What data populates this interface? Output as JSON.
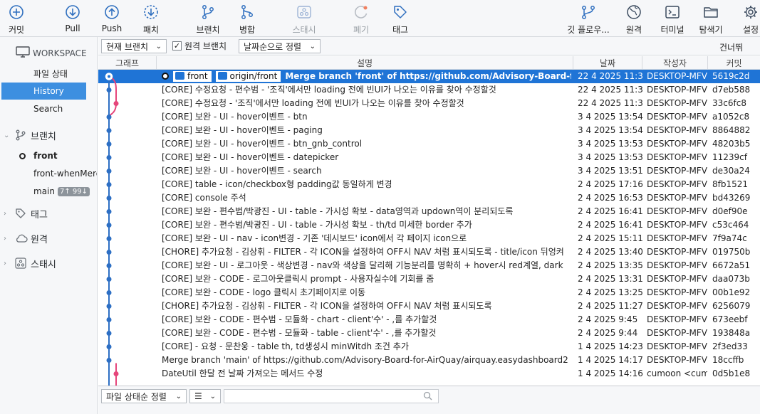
{
  "toolbar": {
    "left": [
      {
        "label": "커밋",
        "icon": "plus-circle-icon"
      },
      {
        "label": "Pull",
        "icon": "arrow-down-circle-icon"
      },
      {
        "label": "Push",
        "icon": "arrow-up-circle-icon"
      },
      {
        "label": "패치",
        "icon": "arrow-down-dashed-circle-icon"
      },
      {
        "label": "브랜치",
        "icon": "branch-icon"
      },
      {
        "label": "병합",
        "icon": "merge-icon"
      },
      {
        "label": "스태시",
        "icon": "stash-icon"
      },
      {
        "label": "폐기",
        "icon": "discard-icon"
      },
      {
        "label": "태그",
        "icon": "tag-icon"
      }
    ],
    "right": [
      {
        "label": "깃 플로우...",
        "icon": "git-flow-icon"
      },
      {
        "label": "원격",
        "icon": "globe-icon"
      },
      {
        "label": "터미널",
        "icon": "terminal-icon"
      },
      {
        "label": "탐색기",
        "icon": "folder-icon"
      },
      {
        "label": "설정",
        "icon": "gear-icon"
      }
    ]
  },
  "sidebar": {
    "workspace_label": "WORKSPACE",
    "workspace_items": [
      "파일 상태",
      "History",
      "Search"
    ],
    "selected_workspace_item": "History",
    "branches_label": "브랜치",
    "branches": [
      {
        "name": "front",
        "current": true
      },
      {
        "name": "front-whenMerge",
        "current": false
      },
      {
        "name": "main",
        "badge": "7↑ 99↓"
      }
    ],
    "tags_label": "태그",
    "remotes_label": "원격",
    "stash_label": "스태시"
  },
  "filter": {
    "branch_select": "현재 브랜치",
    "remote_branches_label": "원격 브랜치",
    "remote_branches_checked": true,
    "sort_select": "날짜순으로 정렬",
    "skip_label": "건너뛰"
  },
  "columns": {
    "graph": "그래프",
    "description": "설명",
    "date": "날짜",
    "author": "작성자",
    "commit": "커밋"
  },
  "commits": [
    {
      "tags": [
        "front",
        "origin/front"
      ],
      "desc": "Merge branch 'front' of https://github.com/Advisory-Board-for-AirQuay/airquay.easydashboard2 into front",
      "date": "22 4 2025 11:3",
      "author": "DESKTOP-MFV",
      "hash": "5619c2d",
      "selected": true
    },
    {
      "desc": "[CORE] 수정요청  - 편수범 - '조직'에서만 loading 전에 빈UI가 나오는 이유를 찾아 수정할것",
      "date": "22 4 2025 11:3",
      "author": "DESKTOP-MFV",
      "hash": "d7eb588"
    },
    {
      "desc": "[CORE] 수정요청 - '조직'에서만 loading 전에 빈UI가 나오는 이유를 찾아 수정할것",
      "date": "22 4 2025 11:3",
      "author": "DESKTOP-MFV",
      "hash": "33c6fc8"
    },
    {
      "desc": "[CORE] 보완 - UI - hover이벤트 - btn",
      "date": "3 4 2025 13:54",
      "author": "DESKTOP-MFV",
      "hash": "a1052c8"
    },
    {
      "desc": "[CORE] 보완 - UI - hover이벤트 - paging",
      "date": "3 4 2025 13:54",
      "author": "DESKTOP-MFV",
      "hash": "8864882"
    },
    {
      "desc": "[CORE] 보완 - UI - hover이벤트 - btn_gnb_control",
      "date": "3 4 2025 13:53",
      "author": "DESKTOP-MFV",
      "hash": "48203b5"
    },
    {
      "desc": "[CORE] 보완 - UI - hover이벤트 - datepicker",
      "date": "3 4 2025 13:53",
      "author": "DESKTOP-MFV",
      "hash": "11239cf"
    },
    {
      "desc": "[CORE] 보완 - UI - hover이벤트 - search",
      "date": "3 4 2025 13:51",
      "author": "DESKTOP-MFV",
      "hash": "de30a24"
    },
    {
      "desc": "[CORE] table - icon/checkbox형 padding값 동일하게 변경",
      "date": "2 4 2025 17:16",
      "author": "DESKTOP-MFV",
      "hash": "8fb1521"
    },
    {
      "desc": "[CORE] console 주석",
      "date": "2 4 2025 16:53",
      "author": "DESKTOP-MFV",
      "hash": "bd43269"
    },
    {
      "desc": "[CORE] 보완 - 편수범/박광진 - UI - table - 가시성 확보 - data영역과 updown역이 분리되도록",
      "date": "2 4 2025 16:41",
      "author": "DESKTOP-MFV",
      "hash": "d0ef90e"
    },
    {
      "desc": "[CORE] 보완 - 편수범/박광진 - UI - table - 가시성 확보 -  th/td 미세한 border 추가",
      "date": "2 4 2025 16:41",
      "author": "DESKTOP-MFV",
      "hash": "c53c464"
    },
    {
      "desc": "[CORE] 보완 - UI - nav - icon변경 - 기존 '데시보드' icon에서 각 페이지 icon으로",
      "date": "2 4 2025 15:11",
      "author": "DESKTOP-MFV",
      "hash": "7f9a74c"
    },
    {
      "desc": "[CHORE]  추가요청 - 김상휘 - FILTER - 각 ICON을 설정하여 OFF시 NAV 처럼 표시되도록 - title/icon 뒤엉켜",
      "date": "2 4 2025 13:40",
      "author": "DESKTOP-MFV",
      "hash": "019750b"
    },
    {
      "desc": "[CORE] 보완 - UI - 로그아웃 - 색상변경 -  nav와 색상을 달리해 기능분리를 명확히 + hover시 red계열, dark",
      "date": "2 4 2025 13:35",
      "author": "DESKTOP-MFV",
      "hash": "6672a51"
    },
    {
      "desc": "[CORE] 보완 - CODE - 로그아웃클릭시 prompt - 사용자실수에 기회를 줌",
      "date": "2 4 2025 13:31",
      "author": "DESKTOP-MFV",
      "hash": "daa073b"
    },
    {
      "desc": "[CORE] 보완 - CODE - logo 클릭시 초기페이지로 이동",
      "date": "2 4 2025 13:25",
      "author": "DESKTOP-MFV",
      "hash": "00b1e92"
    },
    {
      "desc": "[CHORE]  추가요청 - 김상휘 - FILTER - 각 ICON을 설정하여 OFF시 NAV 처럼 표시되도록",
      "date": "2 4 2025 11:27",
      "author": "DESKTOP-MFV",
      "hash": "6256079"
    },
    {
      "desc": "[CORE] 보완 - CODE - 편수범 - 모듈화 - chart - client'수' - ,를 추가할것",
      "date": "2 4 2025 9:45",
      "author": "DESKTOP-MFV",
      "hash": "673eebf"
    },
    {
      "desc": "[CORE] 보완 - CODE - 편수범 - 모듈화 - table - client'수' - ,를 추가할것",
      "date": "2 4 2025 9:44",
      "author": "DESKTOP-MFV",
      "hash": "193848a"
    },
    {
      "desc": "[CORE] - 요청 - 문찬웅 - table th, td생성시 minWitdh 조건 추가",
      "date": "1 4 2025 14:23",
      "author": "DESKTOP-MFV",
      "hash": "2f3ed33"
    },
    {
      "desc": "Merge branch 'main' of https://github.com/Advisory-Board-for-AirQuay/airquay.easydashboard2 into front",
      "date": "1 4 2025 14:17",
      "author": "DESKTOP-MFV",
      "hash": "18ccffb"
    },
    {
      "desc": "DateUtil 한달 전 날짜 가져오는 메서드 수정",
      "date": "1 4 2025 14:16",
      "author": "cumoon <cum",
      "hash": "0d5b1e8"
    }
  ],
  "bottom": {
    "file_sort_select": "파일 상태순 정렬"
  },
  "colors": {
    "selection": "#1f74d6",
    "sidebar_selection": "#3d8fe0",
    "graph_blue": "#2d6fc4",
    "graph_pink": "#e6457a",
    "toolbar_icon": "#2f6fbf"
  }
}
